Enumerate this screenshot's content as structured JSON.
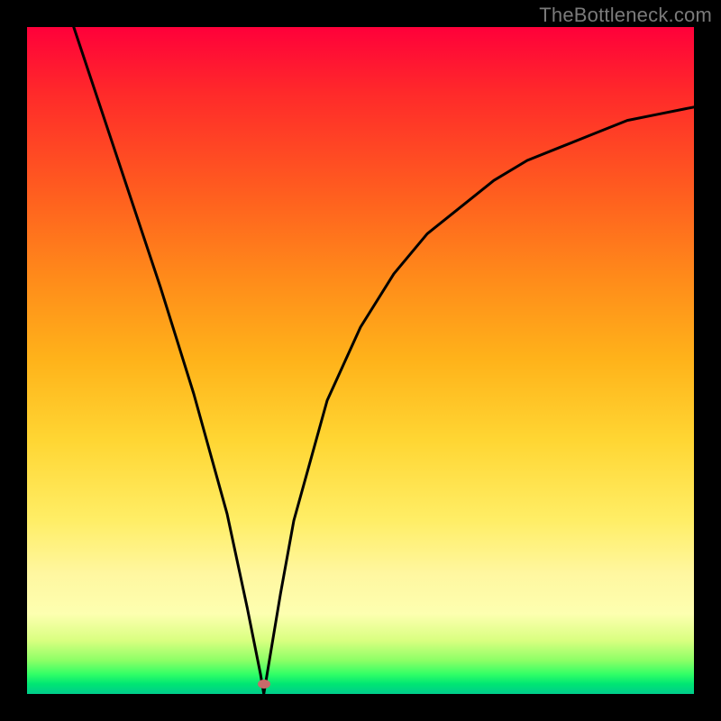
{
  "watermark": "TheBottleneck.com",
  "colors": {
    "background": "#000000",
    "curve": "#000000",
    "marker": "#c86a6a",
    "gradient_top": "#ff003a",
    "gradient_bottom": "#00cc8c"
  },
  "marker": {
    "x_frac": 0.355,
    "y_frac": 0.985
  },
  "chart_data": {
    "type": "line",
    "title": "",
    "xlabel": "",
    "ylabel": "",
    "xlim": [
      0,
      100
    ],
    "ylim": [
      0,
      100
    ],
    "grid": false,
    "legend": false,
    "series": [
      {
        "name": "curve",
        "x": [
          7,
          10,
          15,
          20,
          25,
          30,
          33,
          35,
          35.5,
          36,
          38,
          40,
          45,
          50,
          55,
          60,
          65,
          70,
          75,
          80,
          85,
          90,
          95,
          100
        ],
        "y": [
          100,
          91,
          76,
          61,
          45,
          27,
          13,
          3,
          0,
          3,
          15,
          26,
          44,
          55,
          63,
          69,
          73,
          77,
          80,
          82,
          84,
          86,
          87,
          88
        ]
      }
    ],
    "annotations": [
      {
        "type": "point",
        "name": "minimum-marker",
        "x": 35.5,
        "y": 1.5
      }
    ]
  }
}
